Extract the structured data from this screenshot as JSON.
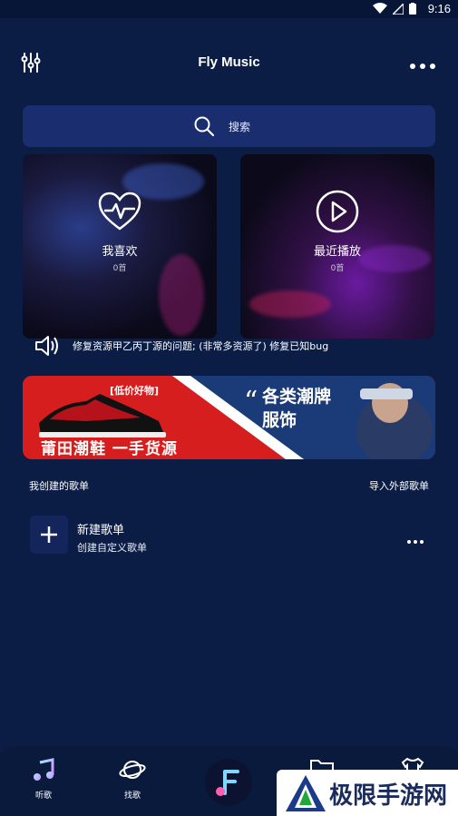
{
  "status": {
    "time": "9:16"
  },
  "header": {
    "title": "Fly Music"
  },
  "search": {
    "placeholder": "搜索"
  },
  "cards": [
    {
      "label": "我喜欢",
      "count": "0首"
    },
    {
      "label": "最近播放",
      "count": "0首"
    }
  ],
  "notice": {
    "text": "修复资源甲乙丙丁源的问题; (非常多资源了) 修复已知bug"
  },
  "banner": {
    "tag": "[低价好物]",
    "big": "莆田潮鞋 一手货源",
    "line1": "各类潮牌",
    "line2": "服饰"
  },
  "section": {
    "left": "我创建的歌单",
    "right": "导入外部歌单"
  },
  "new_playlist": {
    "name": "新建歌单",
    "sub": "创建自定义歌单"
  },
  "tabs": [
    {
      "label": "听歌"
    },
    {
      "label": "找歌"
    }
  ],
  "watermark": {
    "text": "极限手游网"
  },
  "colors": {
    "background": "#0b1c45",
    "search": "#1a2d6e",
    "accent": "#d61e1e"
  }
}
